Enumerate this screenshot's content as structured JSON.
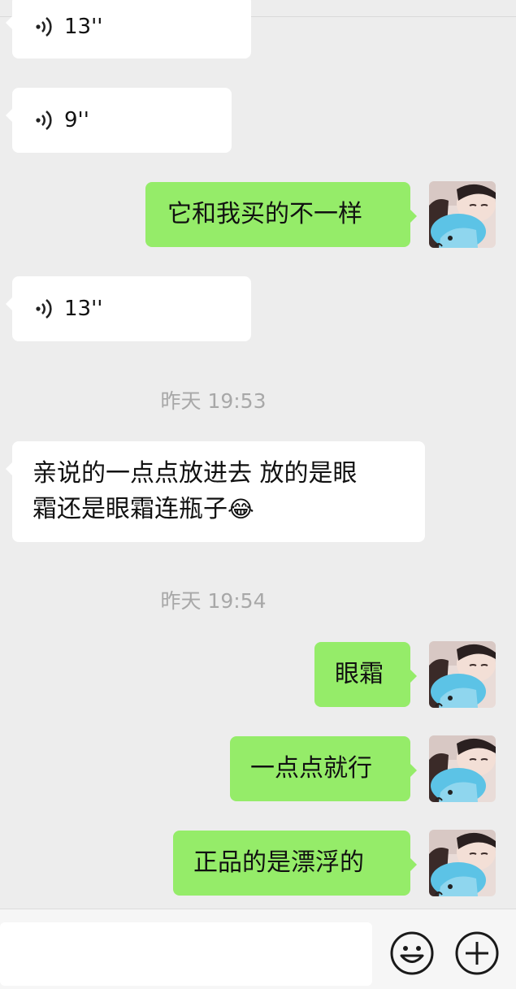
{
  "messages": [
    {
      "kind": "voice",
      "side": "left",
      "duration": "13''"
    },
    {
      "kind": "voice",
      "side": "left",
      "duration": "9''"
    },
    {
      "kind": "text",
      "side": "right",
      "text": "它和我买的不一样"
    },
    {
      "kind": "voice",
      "side": "left",
      "duration": "13''"
    },
    {
      "kind": "time",
      "text": "昨天 19:53"
    },
    {
      "kind": "text",
      "side": "left",
      "line1": "亲说的一点点放进去 放的是眼",
      "line2": "霜还是眼霜连瓶子",
      "emoji": "😂"
    },
    {
      "kind": "time",
      "text": "昨天 19:54"
    },
    {
      "kind": "text",
      "side": "right",
      "text": "眼霜"
    },
    {
      "kind": "text",
      "side": "right",
      "text": "一点点就行"
    },
    {
      "kind": "text",
      "side": "right",
      "text": "正品的是漂浮的"
    }
  ],
  "input_bar": {
    "emoji_icon": "smiley-face-icon",
    "plus_icon": "plus-circle-icon"
  },
  "colors": {
    "background": "#ededed",
    "sent_bubble": "#95ec69",
    "received_bubble": "#ffffff",
    "timestamp": "#a8a8a8"
  }
}
